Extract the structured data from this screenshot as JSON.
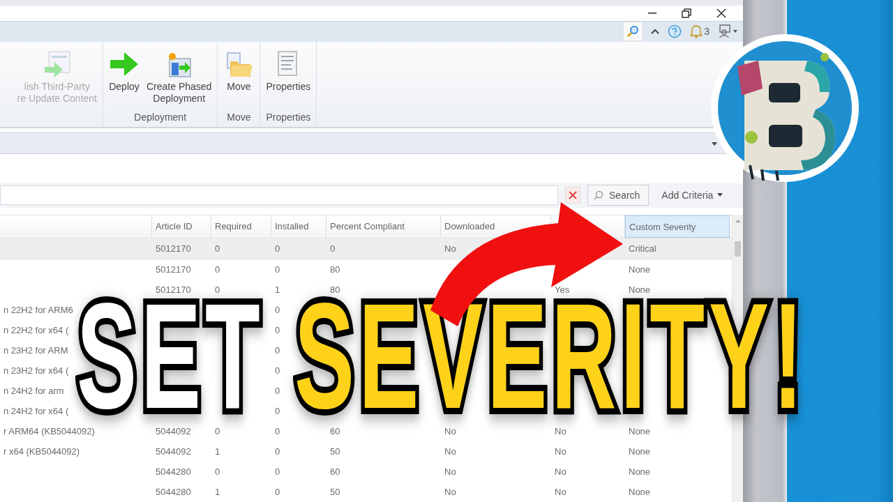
{
  "window": {
    "notification_count": "3"
  },
  "ribbon": {
    "groups": [
      {
        "items": [
          {
            "kind": "publish",
            "lines": [
              "lish Third-Party",
              "re Update Content"
            ],
            "disabled": true
          }
        ]
      },
      {
        "label": "Deployment",
        "items": [
          {
            "kind": "deploy",
            "lines": [
              "Deploy"
            ],
            "disabled": false
          },
          {
            "kind": "phased",
            "lines": [
              "Create Phased",
              "Deployment"
            ],
            "disabled": false
          }
        ]
      },
      {
        "label": "Move",
        "items": [
          {
            "kind": "move",
            "lines": [
              "Move"
            ],
            "disabled": false
          }
        ]
      },
      {
        "label": "Properties",
        "items": [
          {
            "kind": "properties",
            "lines": [
              "Properties"
            ],
            "disabled": false
          }
        ]
      }
    ]
  },
  "search_bar": {
    "search_button": "Search",
    "add_criteria": "Add Criteria"
  },
  "table": {
    "columns": [
      {
        "selected": false
      },
      {
        "label": "Article ID",
        "selected": false
      },
      {
        "label": "Required",
        "selected": false
      },
      {
        "label": "Installed",
        "selected": false
      },
      {
        "label": "Percent Compliant",
        "selected": false
      },
      {
        "label": "Downloaded",
        "selected": false
      },
      {
        "selected": false
      },
      {
        "label": "Custom Severity",
        "selected": true
      }
    ],
    "rows": [
      {
        "selected": true,
        "cells": [
          null,
          "5012170",
          "0",
          "0",
          "0",
          "No",
          null,
          "Critical"
        ]
      },
      {
        "selected": false,
        "cells": [
          null,
          "5012170",
          "0",
          "0",
          "80",
          null,
          null,
          "None"
        ]
      },
      {
        "selected": false,
        "cells": [
          null,
          "5012170",
          "0",
          "1",
          "80",
          null,
          "Yes",
          "None"
        ]
      },
      {
        "selected": false,
        "cells": [
          "n 22H2 for ARM6",
          null,
          null,
          "0",
          null,
          null,
          null,
          null
        ]
      },
      {
        "selected": false,
        "cells": [
          "n 22H2 for x64 (",
          null,
          null,
          "0",
          null,
          null,
          null,
          null
        ]
      },
      {
        "selected": false,
        "cells": [
          "n 23H2 for ARM",
          null,
          null,
          "0",
          null,
          null,
          null,
          null
        ]
      },
      {
        "selected": false,
        "cells": [
          "n 23H2 for x64 (",
          null,
          null,
          "0",
          null,
          null,
          null,
          null
        ]
      },
      {
        "selected": false,
        "cells": [
          "n 24H2 for arm",
          null,
          null,
          "0",
          null,
          null,
          null,
          null
        ]
      },
      {
        "selected": false,
        "cells": [
          "n 24H2 for x64 (",
          null,
          null,
          "0",
          null,
          null,
          null,
          null
        ]
      },
      {
        "selected": false,
        "cells": [
          "r ARM64 (KB5044092)",
          "5044092",
          "0",
          "0",
          "60",
          "No",
          "No",
          "None"
        ]
      },
      {
        "selected": false,
        "cells": [
          "r x64 (KB5044092)",
          "5044092",
          "1",
          "0",
          "50",
          "No",
          "No",
          "None"
        ]
      },
      {
        "selected": false,
        "cells": [
          null,
          "5044280",
          "0",
          "0",
          "60",
          "No",
          "No",
          "None"
        ]
      },
      {
        "selected": false,
        "cells": [
          null,
          "5044280",
          "1",
          "0",
          "50",
          "No",
          "No",
          "None"
        ]
      }
    ]
  },
  "headline": [
    {
      "text": "SET",
      "color": "#ffffff"
    },
    {
      "text": "SEVERITY!",
      "color": "#ffd21a"
    }
  ]
}
